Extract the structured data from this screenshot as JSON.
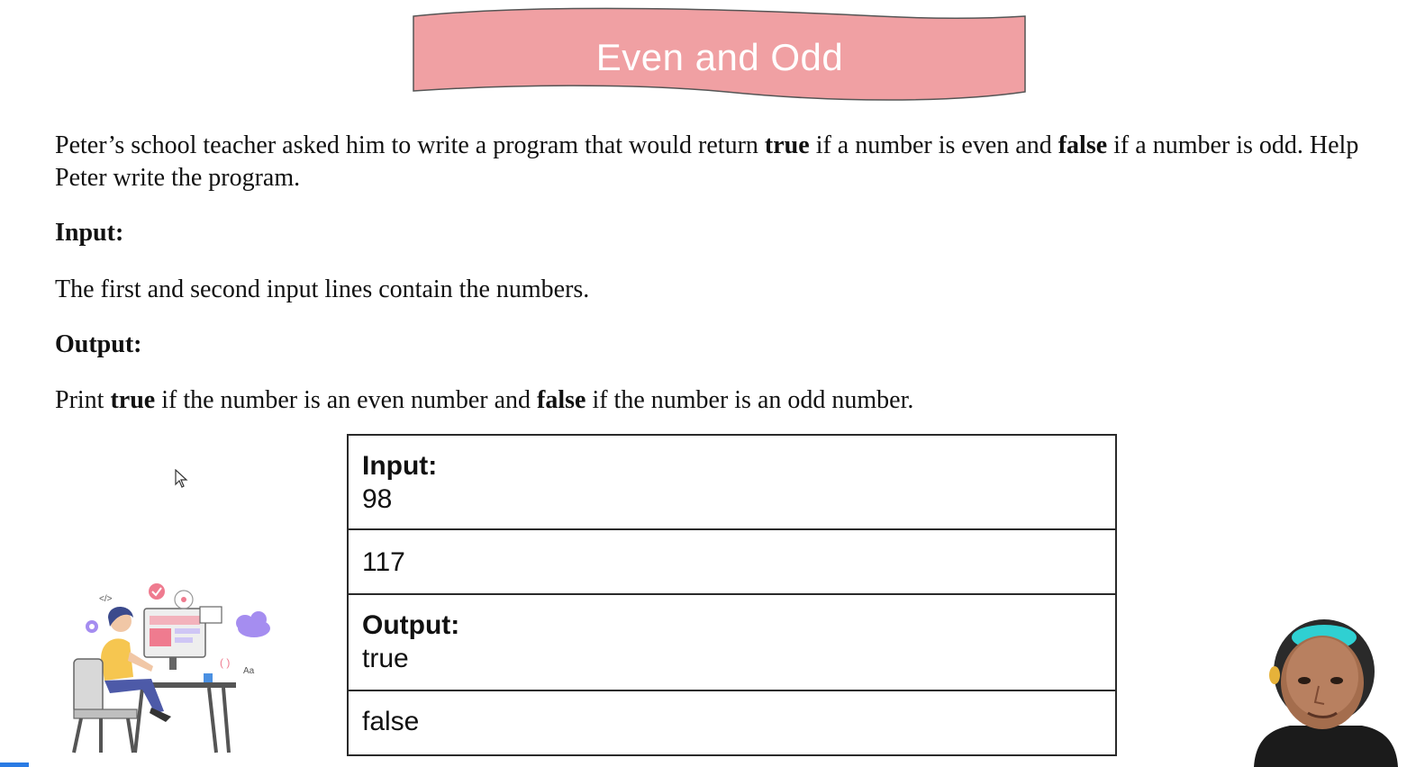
{
  "title": "Even and Odd",
  "problem": {
    "intro_parts": [
      "Peter’s school teacher asked him to write a program that would return ",
      "true",
      " if a number is even and ",
      "false",
      " if a number is odd. Help Peter write the program."
    ],
    "input_heading": "Input:",
    "input_text": "The first and second input lines contain the numbers.",
    "output_heading": "Output:",
    "output_parts": [
      "Print ",
      "true",
      " if the number is an even number and ",
      "false",
      " if the number is an odd number."
    ]
  },
  "example": {
    "input_label": "Input:",
    "input_line1": "98",
    "input_line2": "117",
    "output_label": "Output:",
    "output_line1": "true",
    "output_line2": "false"
  },
  "illustration_marks": {
    "code_tag": "</>",
    "font_tag": "Aa",
    "parens": "( )"
  },
  "colors": {
    "banner_fill": "#f0a0a3",
    "banner_stroke": "#555555",
    "accent_blue": "#2a7be4"
  }
}
